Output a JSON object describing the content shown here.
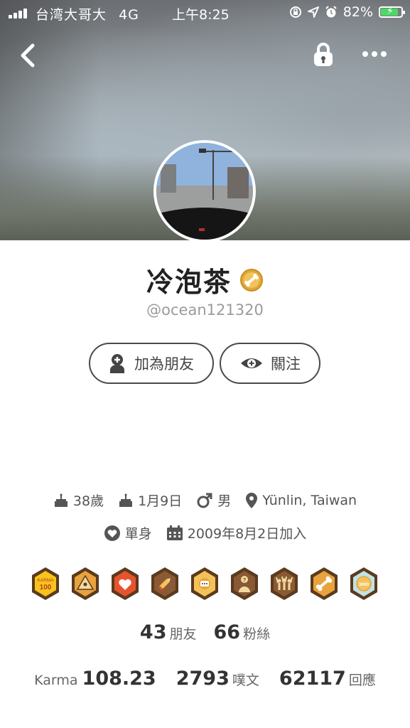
{
  "status_bar": {
    "carrier": "台湾大哥大",
    "network": "4G",
    "time": "上午8:25",
    "battery_percent": "82%"
  },
  "profile": {
    "display_name": "冷泡茶",
    "handle": "@ocean121320"
  },
  "actions": {
    "add_friend_label": "加為朋友",
    "follow_label": "關注"
  },
  "info": {
    "age": "38歲",
    "birthday": "1月9日",
    "gender": "男",
    "location": "Yünlin, Taiwan",
    "relationship": "單身",
    "joined": "2009年8月2日加入"
  },
  "badges": [
    {
      "icon": "karma-100-badge-icon",
      "text_line1": "KARMA",
      "text_line2": "100"
    },
    {
      "icon": "eye-pyramid-badge-icon"
    },
    {
      "icon": "heart-badge-icon"
    },
    {
      "icon": "pencil-badge-icon"
    },
    {
      "icon": "sun-chat-badge-icon"
    },
    {
      "icon": "question-person-badge-icon"
    },
    {
      "icon": "group-cheer-badge-icon"
    },
    {
      "icon": "bone-badge-icon"
    },
    {
      "icon": "3000-badge-icon",
      "text": "3000"
    }
  ],
  "stats": {
    "friends_count": "43",
    "friends_label": "朋友",
    "fans_count": "66",
    "fans_label": "粉絲",
    "karma_label": "Karma",
    "karma_value": "108.23",
    "posts_count": "2793",
    "posts_label": "噗文",
    "replies_count": "62117",
    "replies_label": "回應"
  },
  "colors": {
    "badge_brown": "#5b3a1e",
    "badge_gold": "#e8a33c",
    "battery_green": "#4cd964",
    "verified_gold": "#e0a93a"
  }
}
